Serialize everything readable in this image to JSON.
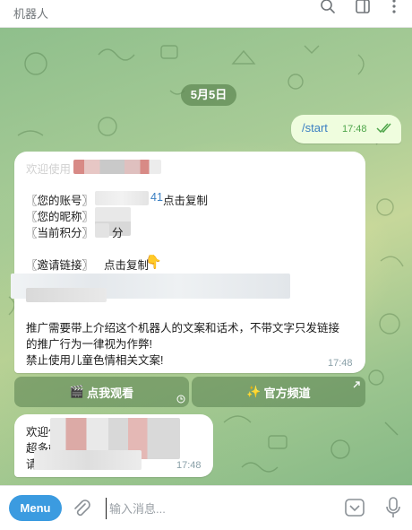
{
  "header": {
    "title": "机器人"
  },
  "chat": {
    "date": "5月5日",
    "outgoing": {
      "text": "/start",
      "time": "17:48"
    },
    "welcome": {
      "greeting": "欢迎使用",
      "account": "〖您的账号〗",
      "account_suffix": "41",
      "copy": "点击复制",
      "nickname": "〖您的昵称〗",
      "points": "〖当前积分〗",
      "points_unit": "分",
      "invite": "〖邀请链接〗",
      "invite_copy": "点击复制",
      "invite_emoji": "👇",
      "rule1": "推广需要带上介绍这个机器人的文案和话术，不带文字只发链接",
      "rule2": "的推广行为一律视为作弊!",
      "rule3": "禁止使用儿童色情相关文案!",
      "time": "17:48"
    },
    "buttons": [
      {
        "emoji": "🎬",
        "label": "点我观看"
      },
      {
        "emoji": "✨",
        "label": "官方频道"
      }
    ],
    "second": {
      "line1": "欢迎使",
      "line2": "超多好",
      "line3": "请",
      "time": "17:48"
    }
  },
  "composer": {
    "menu_label": "Menu",
    "placeholder": "输入消息..."
  },
  "colors": {
    "accent": "#3b9be0",
    "outgoing_bubble": "#effdde",
    "check": "#4ea54a"
  },
  "icons": [
    "search-icon",
    "columns-icon",
    "more-icon",
    "double-check-icon",
    "clock-icon",
    "arrow-up-right-icon",
    "paperclip-icon",
    "command-icon",
    "microphone-icon"
  ]
}
